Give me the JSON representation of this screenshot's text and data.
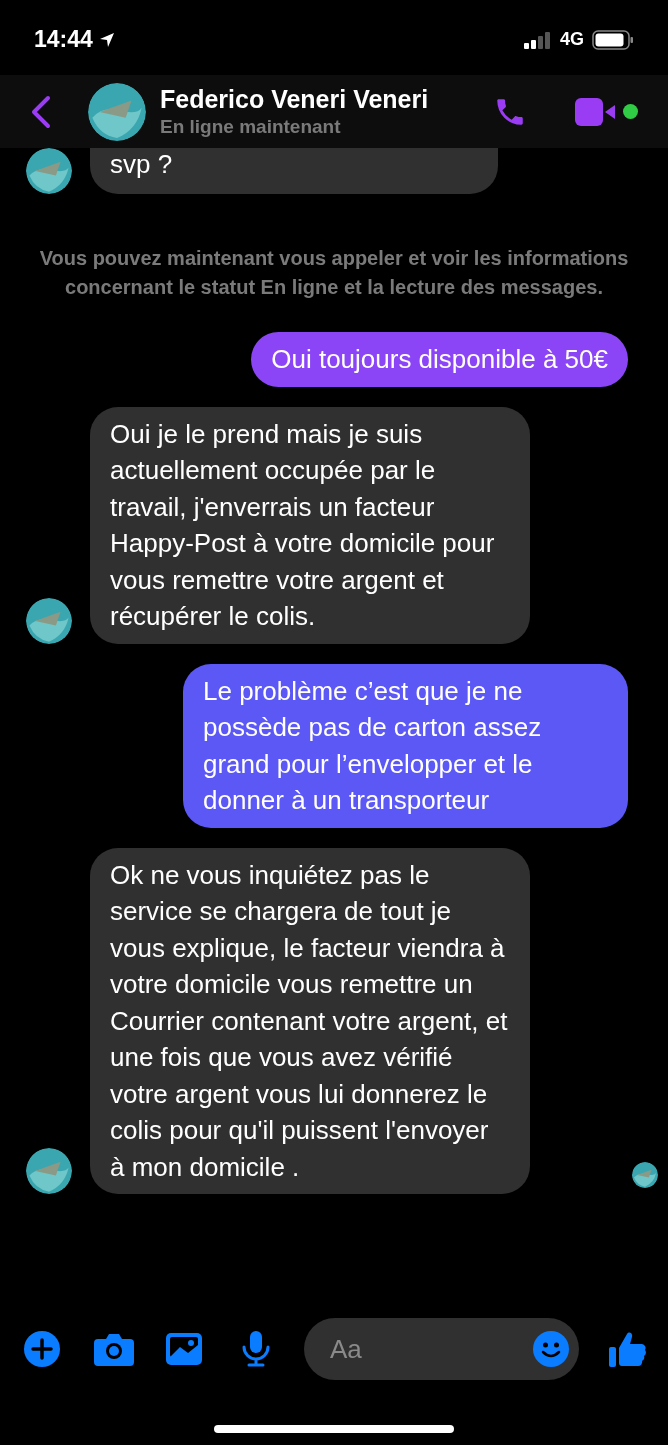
{
  "status_bar": {
    "time": "14:44",
    "network": "4G"
  },
  "header": {
    "name": "Federico Veneri Veneri",
    "status": "En ligne maintenant",
    "online": true
  },
  "messages": [
    {
      "kind": "incoming",
      "text": "svp ?",
      "avatar": true,
      "seen": false
    },
    {
      "kind": "system",
      "text": "Vous pouvez maintenant vous appeler et voir les informations concernant le statut En ligne et la lecture des messages."
    },
    {
      "kind": "outgoing",
      "text": "Oui toujours disponible à 50€"
    },
    {
      "kind": "incoming",
      "text": "Oui je le prend mais je suis actuellement occupée par le travail, j'enverrais un facteur Happy-Post à votre domicile pour vous remettre votre argent et récupérer le colis.",
      "avatar": true,
      "seen": false
    },
    {
      "kind": "outgoing",
      "text": "Le problème c’est que je ne possède pas de carton assez grand pour l’envelopper et le donner à un transporteur"
    },
    {
      "kind": "incoming",
      "text": "Ok ne vous inquiétez pas le service se chargera de tout je vous explique, le facteur viendra à votre domicile vous remettre un Courrier contenant votre argent, et une fois que vous avez vérifié votre argent vous lui donnerez le colis pour qu'il puissent l'envoyer à mon domicile .",
      "avatar": true,
      "seen": true
    }
  ],
  "composer": {
    "placeholder": "Aa"
  }
}
